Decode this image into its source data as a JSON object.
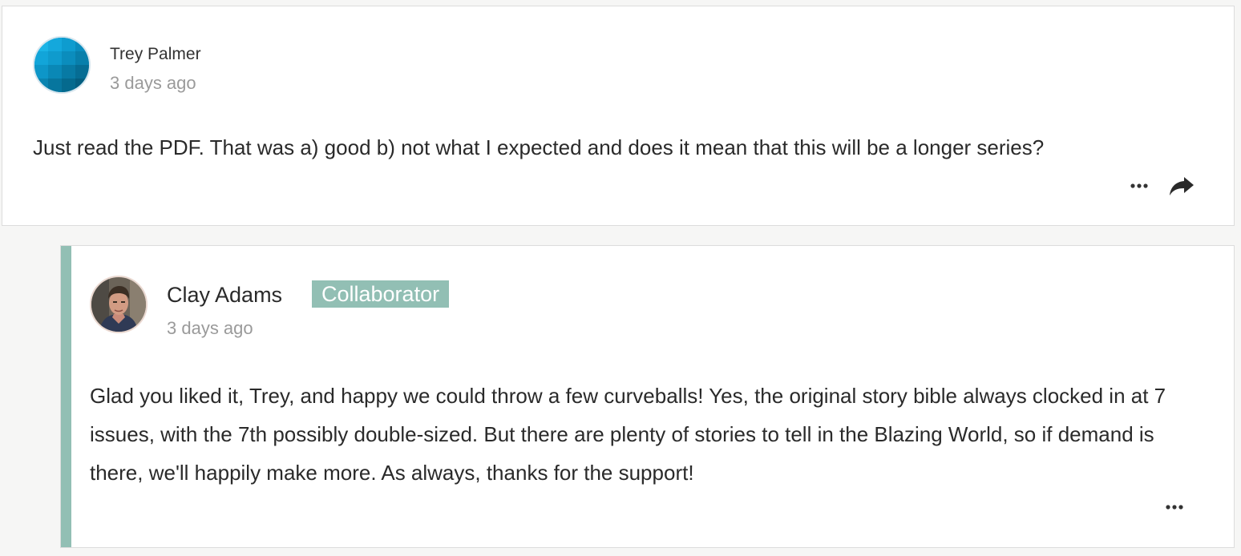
{
  "colors": {
    "accent": "#92bfb4",
    "avatar_primary": "#0b8fc2",
    "text": "#2a2a2a",
    "muted": "#9a9a9a"
  },
  "comments": [
    {
      "author": "Trey Palmer",
      "timestamp": "3 days ago",
      "body": "Just read the PDF. That was a) good b) not what I expected and does it mean that this will be a longer series?",
      "avatar_icon": "geometric-avatar-icon",
      "actions": [
        "more-options-icon",
        "share-icon"
      ]
    }
  ],
  "reply": {
    "author": "Clay Adams",
    "badge": "Collaborator",
    "timestamp": "3 days ago",
    "body": "Glad you liked it, Trey, and happy we could throw a few curveballs! Yes, the original story bible always clocked in at 7 issues, with the 7th possibly double-sized. But there are plenty of stories to tell in the Blazing World, so if demand is there, we'll happily make more. As always, thanks for the support!",
    "avatar_icon": "user-photo-avatar",
    "actions": [
      "more-options-icon"
    ]
  }
}
